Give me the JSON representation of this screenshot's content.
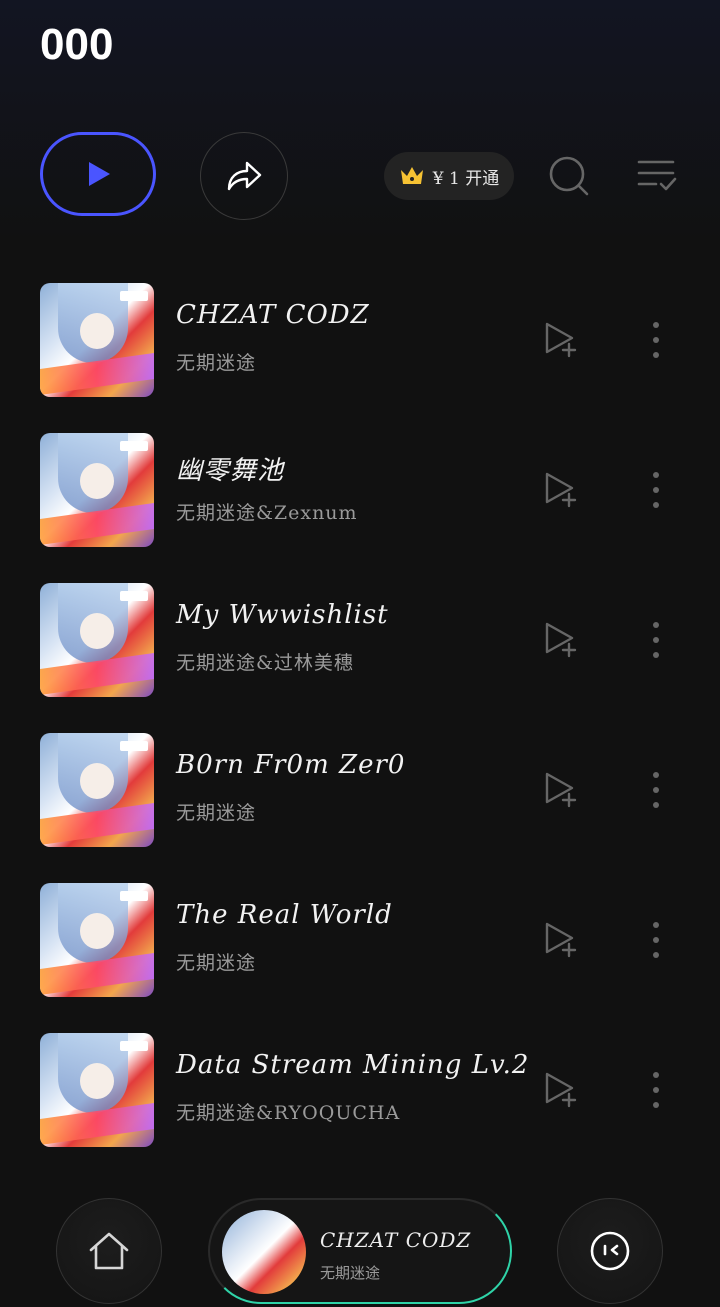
{
  "header": {
    "title": "000"
  },
  "toolbar": {
    "vip": {
      "price_label": "¥ 1 开通"
    }
  },
  "songs": [
    {
      "title": "CHZAT CODZ",
      "artist": "无期迷途"
    },
    {
      "title": "幽零舞池",
      "artist": "无期迷途&Zexnum"
    },
    {
      "title": "My Wwwishlist",
      "artist": "无期迷途&过林美穗"
    },
    {
      "title": "B0rn Fr0m Zer0",
      "artist": "无期迷途"
    },
    {
      "title": "The Real World",
      "artist": "无期迷途"
    },
    {
      "title": "Data Stream Mining Lv.2",
      "artist": "无期迷途&RYOQUCHA"
    }
  ],
  "player": {
    "title": "CHZAT CODZ",
    "artist": "无期迷途"
  },
  "colors": {
    "accent": "#4a55ff",
    "progress": "#2fd3a8",
    "vip_crown": "#f6c233"
  }
}
